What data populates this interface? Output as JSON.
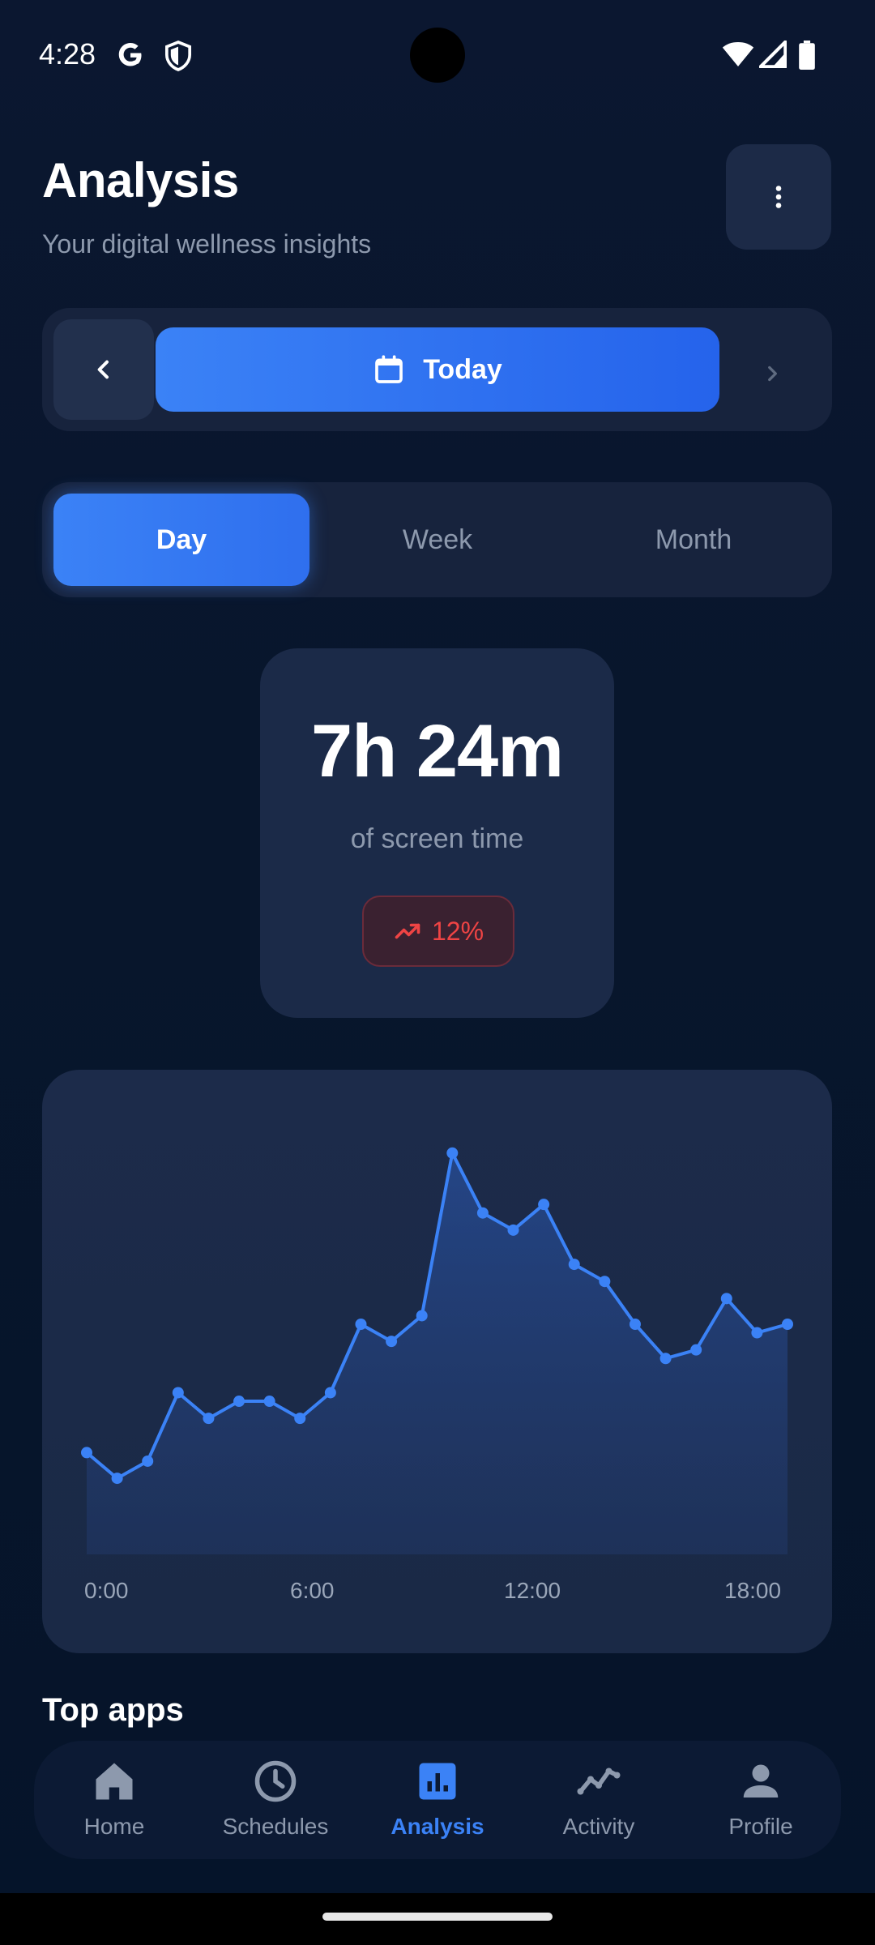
{
  "status_bar": {
    "time": "4:28"
  },
  "header": {
    "title": "Analysis",
    "subtitle": "Your digital wellness insights",
    "menu_icon": "more-vert-icon"
  },
  "date_nav": {
    "prev_icon": "chevron-left-icon",
    "current_label": "Today",
    "calendar_icon": "calendar-icon",
    "next_icon": "chevron-right-icon"
  },
  "period_tabs": [
    {
      "label": "Day",
      "active": true
    },
    {
      "label": "Week",
      "active": false
    },
    {
      "label": "Month",
      "active": false
    }
  ],
  "summary": {
    "total": "7h 24m",
    "caption": "of screen time",
    "change": "12%",
    "change_icon": "trending-up-icon",
    "change_color": "#ef4444"
  },
  "chart_data": {
    "type": "area",
    "x_tick_labels": [
      "0:00",
      "6:00",
      "12:00",
      "18:00"
    ],
    "values": [
      20,
      14,
      18,
      34,
      28,
      32,
      32,
      28,
      34,
      50,
      46,
      52,
      90,
      76,
      72,
      78,
      64,
      60,
      50,
      42,
      44,
      56,
      48,
      50
    ],
    "ylim": [
      0,
      100
    ],
    "color": "#3b82f6",
    "grid": false
  },
  "sections": {
    "top_apps": "Top apps"
  },
  "bottom_nav": [
    {
      "label": "Home",
      "icon": "home-icon",
      "active": false
    },
    {
      "label": "Schedules",
      "icon": "clock-icon",
      "active": false
    },
    {
      "label": "Analysis",
      "icon": "bar-chart-icon",
      "active": true
    },
    {
      "label": "Activity",
      "icon": "activity-icon",
      "active": false
    },
    {
      "label": "Profile",
      "icon": "person-icon",
      "active": false
    }
  ],
  "colors": {
    "accent": "#3b82f6",
    "background": "#08162c",
    "card": "#1b2a48"
  }
}
